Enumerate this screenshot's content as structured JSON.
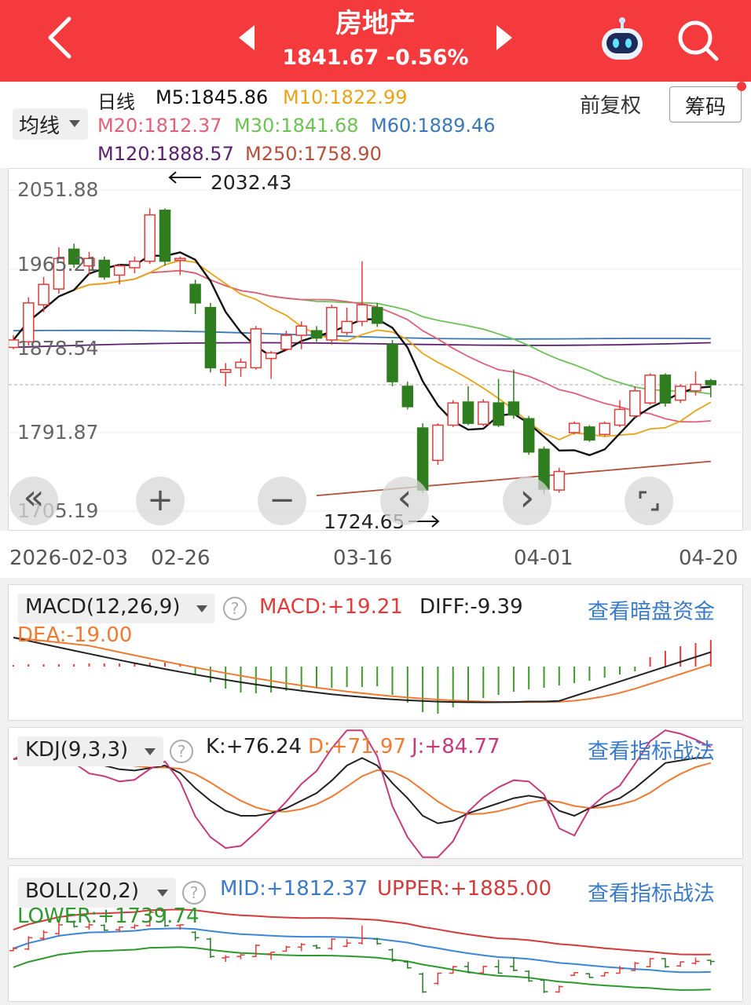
{
  "header": {
    "title": "房地产",
    "subtitle": "1841.67 -0.56%"
  },
  "ma": {
    "period": "日线",
    "avg_label": "均线",
    "m5": "M5:1845.86",
    "m10": "M10:1822.99",
    "m20": "M20:1812.37",
    "m30": "M30:1841.68",
    "m60": "M60:1889.46",
    "m120": "M120:1888.57",
    "m250": "M250:1758.90",
    "adjust": "前复权",
    "chip": "筹码"
  },
  "colors": {
    "header_bg": "#f43a3d",
    "up": "#e23b3b",
    "down": "#2e7d1f",
    "m5": "#111111",
    "m10": "#e8a317",
    "m20": "#e0607a",
    "m30": "#6cc255",
    "m60": "#3a78b5",
    "m120": "#5b1f6e",
    "m250": "#b5503a",
    "link": "#3b7bc9"
  },
  "main_chart": {
    "y_labels": [
      "2051.88",
      "1965.21",
      "1878.54",
      "1791.87",
      "1705.19"
    ],
    "high_label": "2032.43",
    "low_label": "1724.65",
    "dates": [
      "2026-02-03",
      "02-26",
      "03-16",
      "04-01",
      "04-20"
    ]
  },
  "controls": {
    "rewind": "«",
    "zoom_in": "+",
    "zoom_out": "−",
    "prev": "‹",
    "next": "›"
  },
  "macd": {
    "name": "MACD(12,26,9)",
    "help": "?",
    "macd": "MACD:+19.21",
    "diff": "DIFF:-9.39",
    "dea": "DEA:-19.00",
    "link": "查看暗盘资金"
  },
  "kdj": {
    "name": "KDJ(9,3,3)",
    "help": "?",
    "k": "K:+76.24",
    "d": "D:+71.97",
    "j": "J:+84.77",
    "link": "查看指标战法"
  },
  "boll": {
    "name": "BOLL(20,2)",
    "help": "?",
    "mid": "MID:+1812.37",
    "upper": "UPPER:+1885.00",
    "lower": "LOWER:+1739.74",
    "link": "查看指标战法"
  },
  "chart_data": {
    "type": "candlestick",
    "y_range": [
      1705.19,
      2051.88
    ],
    "x_dates_labeled": [
      "2026-02-03",
      "02-26",
      "03-16",
      "04-01",
      "04-20"
    ],
    "candles": [
      {
        "o": 1882,
        "c": 1890,
        "h": 1895,
        "l": 1880
      },
      {
        "o": 1888,
        "c": 1930,
        "h": 1936,
        "l": 1884
      },
      {
        "o": 1928,
        "c": 1950,
        "h": 1958,
        "l": 1920
      },
      {
        "o": 1945,
        "c": 1978,
        "h": 1990,
        "l": 1940
      },
      {
        "o": 1988,
        "c": 1972,
        "h": 1994,
        "l": 1968
      },
      {
        "o": 1970,
        "c": 1978,
        "h": 1985,
        "l": 1960
      },
      {
        "o": 1976,
        "c": 1958,
        "h": 1980,
        "l": 1955
      },
      {
        "o": 1960,
        "c": 1970,
        "h": 1972,
        "l": 1950
      },
      {
        "o": 1968,
        "c": 1975,
        "h": 1980,
        "l": 1962
      },
      {
        "o": 1975,
        "c": 2025,
        "h": 2032,
        "l": 1972
      },
      {
        "o": 2030,
        "c": 1975,
        "h": 2032,
        "l": 1970
      },
      {
        "o": 1976,
        "c": 1978,
        "h": 1980,
        "l": 1960
      },
      {
        "o": 1950,
        "c": 1930,
        "h": 1955,
        "l": 1918
      },
      {
        "o": 1925,
        "c": 1860,
        "h": 1930,
        "l": 1855
      },
      {
        "o": 1855,
        "c": 1858,
        "h": 1865,
        "l": 1840
      },
      {
        "o": 1860,
        "c": 1866,
        "h": 1870,
        "l": 1850
      },
      {
        "o": 1860,
        "c": 1902,
        "h": 1905,
        "l": 1858
      },
      {
        "o": 1870,
        "c": 1876,
        "h": 1878,
        "l": 1848
      },
      {
        "o": 1880,
        "c": 1895,
        "h": 1900,
        "l": 1878
      },
      {
        "o": 1895,
        "c": 1905,
        "h": 1910,
        "l": 1880
      },
      {
        "o": 1900,
        "c": 1892,
        "h": 1905,
        "l": 1888
      },
      {
        "o": 1890,
        "c": 1925,
        "h": 1928,
        "l": 1885
      },
      {
        "o": 1898,
        "c": 1910,
        "h": 1925,
        "l": 1895
      },
      {
        "o": 1910,
        "c": 1928,
        "h": 1975,
        "l": 1905
      },
      {
        "o": 1925,
        "c": 1908,
        "h": 1930,
        "l": 1904
      },
      {
        "o": 1885,
        "c": 1845,
        "h": 1890,
        "l": 1840
      },
      {
        "o": 1840,
        "c": 1818,
        "h": 1845,
        "l": 1815
      },
      {
        "o": 1795,
        "c": 1728,
        "h": 1800,
        "l": 1724.65
      },
      {
        "o": 1760,
        "c": 1798,
        "h": 1800,
        "l": 1755
      },
      {
        "o": 1798,
        "c": 1822,
        "h": 1825,
        "l": 1796
      },
      {
        "o": 1823,
        "c": 1800,
        "h": 1840,
        "l": 1798
      },
      {
        "o": 1799,
        "c": 1823,
        "h": 1826,
        "l": 1797
      },
      {
        "o": 1822,
        "c": 1798,
        "h": 1848,
        "l": 1796
      },
      {
        "o": 1823,
        "c": 1809,
        "h": 1858,
        "l": 1805
      },
      {
        "o": 1805,
        "c": 1769,
        "h": 1808,
        "l": 1766
      },
      {
        "o": 1772,
        "c": 1729,
        "h": 1775,
        "l": 1724
      },
      {
        "o": 1728,
        "c": 1748,
        "h": 1752,
        "l": 1725
      },
      {
        "o": 1790,
        "c": 1800,
        "h": 1802,
        "l": 1788
      },
      {
        "o": 1796,
        "c": 1782,
        "h": 1798,
        "l": 1780
      },
      {
        "o": 1788,
        "c": 1800,
        "h": 1802,
        "l": 1786
      },
      {
        "o": 1798,
        "c": 1815,
        "h": 1825,
        "l": 1796
      },
      {
        "o": 1808,
        "c": 1835,
        "h": 1840,
        "l": 1806
      },
      {
        "o": 1822,
        "c": 1852,
        "h": 1854,
        "l": 1820
      },
      {
        "o": 1852,
        "c": 1822,
        "h": 1854,
        "l": 1818
      },
      {
        "o": 1825,
        "c": 1840,
        "h": 1842,
        "l": 1822
      },
      {
        "o": 1835,
        "c": 1842,
        "h": 1856,
        "l": 1830
      },
      {
        "o": 1846,
        "c": 1841.67,
        "h": 1848,
        "l": 1828
      }
    ]
  }
}
